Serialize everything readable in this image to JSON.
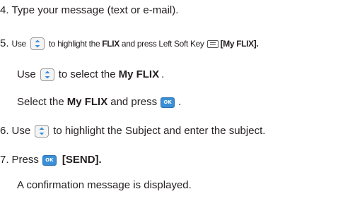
{
  "steps": {
    "s4": {
      "num": "4.",
      "text": "Type your message (text or e-mail)."
    },
    "s5": {
      "num": "5.",
      "use": "Use",
      "to_highlight": "to highlight the",
      "flix": "FLIX",
      "and_press": "and press Left Soft Key",
      "my_flix_key": "[My FLIX]."
    },
    "s5a": {
      "use": "Use",
      "to_select": "to select the",
      "my_flix": "My FLIX",
      "period": "."
    },
    "s5b": {
      "select_the": "Select the",
      "my_flix": "My FLIX",
      "and_press": "and press",
      "period": "."
    },
    "s6": {
      "num": "6.",
      "use": "Use",
      "text": "to highlight the Subject and enter the subject."
    },
    "s7": {
      "num": "7.",
      "press": "Press",
      "send": "[SEND]."
    },
    "s7a": {
      "text": "A confirmation message is displayed."
    }
  },
  "keys": {
    "ok_label": "OK"
  },
  "icons": {
    "nav_key": "navigation-key-icon",
    "ok_key": "ok-key-icon",
    "left_soft_key": "left-soft-key-icon"
  }
}
